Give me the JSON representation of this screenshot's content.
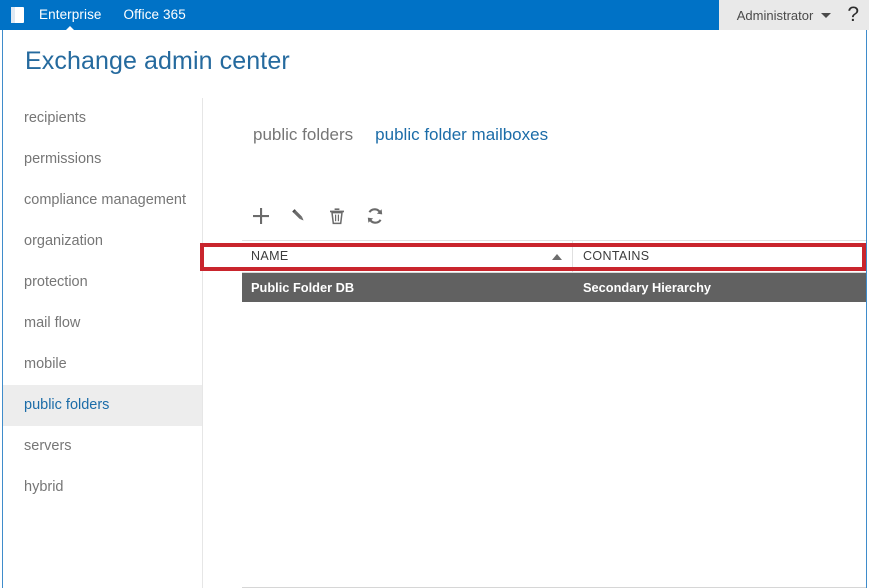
{
  "suite_bar": {
    "logo_icon": "office-logo-icon",
    "links": [
      {
        "label": "Enterprise",
        "active": true
      },
      {
        "label": "Office 365",
        "active": false
      }
    ],
    "account": {
      "name": "Administrator",
      "caret_icon": "chevron-down-icon",
      "help_icon": "question-mark-icon",
      "help_glyph": "?"
    },
    "background_color": "#0072c6",
    "account_background_color": "#e9e9e9"
  },
  "header": {
    "title": "Exchange admin center",
    "title_color": "#256a9e"
  },
  "sidebar": {
    "items": [
      {
        "label": "recipients",
        "selected": false
      },
      {
        "label": "permissions",
        "selected": false
      },
      {
        "label": "compliance management",
        "selected": false
      },
      {
        "label": "organization",
        "selected": false
      },
      {
        "label": "protection",
        "selected": false
      },
      {
        "label": "mail flow",
        "selected": false
      },
      {
        "label": "mobile",
        "selected": false
      },
      {
        "label": "public folders",
        "selected": true
      },
      {
        "label": "servers",
        "selected": false
      },
      {
        "label": "hybrid",
        "selected": false
      }
    ],
    "selected_background_color": "#ededed",
    "selected_text_color": "#1b6ca8"
  },
  "main": {
    "tabs": [
      {
        "label": "public folders",
        "active": false
      },
      {
        "label": "public folder mailboxes",
        "active": true
      }
    ],
    "toolbar": [
      {
        "name": "add-button",
        "icon": "plus-icon",
        "title": "Add"
      },
      {
        "name": "edit-button",
        "icon": "pencil-icon",
        "title": "Edit"
      },
      {
        "name": "delete-button",
        "icon": "trash-icon",
        "title": "Delete"
      },
      {
        "name": "refresh-button",
        "icon": "refresh-icon",
        "title": "Refresh"
      }
    ],
    "table": {
      "columns": [
        {
          "label": "NAME",
          "sort": "ascending",
          "sort_icon": "sort-ascending-icon"
        },
        {
          "label": "CONTAINS",
          "sort": "none"
        }
      ],
      "rows": [
        {
          "name": "Public Folder DB",
          "contains": "Secondary Hierarchy",
          "selected": true
        }
      ],
      "selected_row_background_color": "#616161"
    }
  },
  "annotation": {
    "highlight_color": "#c9252d",
    "target": "selected-table-row"
  }
}
